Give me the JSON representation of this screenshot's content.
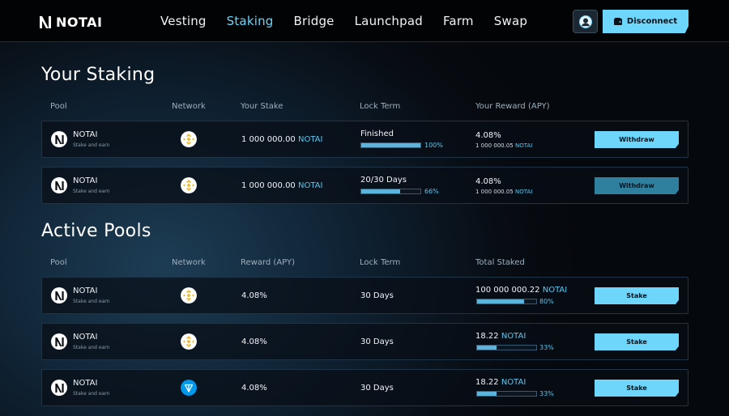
{
  "brand": {
    "name": "NOTAI"
  },
  "nav": {
    "links": [
      "Vesting",
      "Staking",
      "Bridge",
      "Launchpad",
      "Farm",
      "Swap"
    ],
    "active": "Staking",
    "disconnect_label": "Disconnect"
  },
  "your_staking": {
    "title": "Your Staking",
    "columns": [
      "Pool",
      "Network",
      "Your Stake",
      "Lock Term",
      "Your Reward (APY)"
    ],
    "rows": [
      {
        "pool_name": "NOTAI",
        "pool_sub": "Stake and earn",
        "network": "bnb-icon",
        "stake_amount": "1 000 000.00",
        "stake_token": "NOTAI",
        "lock_label": "Finished",
        "lock_progress": 100,
        "lock_pct": "100%",
        "apy": "4.08%",
        "reward_amount": "1 000 000.05",
        "reward_token": "NOTAI",
        "action": "Withdraw",
        "action_enabled": true
      },
      {
        "pool_name": "NOTAI",
        "pool_sub": "Stake and earn",
        "network": "bnb-icon",
        "stake_amount": "1 000 000.00",
        "stake_token": "NOTAI",
        "lock_label": "20/30 Days",
        "lock_progress": 66,
        "lock_pct": "66%",
        "apy": "4.08%",
        "reward_amount": "1 000 000.05",
        "reward_token": "NOTAI",
        "action": "Withdraw",
        "action_enabled": false
      }
    ]
  },
  "active_pools": {
    "title": "Active Pools",
    "columns": [
      "Pool",
      "Network",
      "Reward (APY)",
      "Lock Term",
      "Total Staked"
    ],
    "rows": [
      {
        "pool_name": "NOTAI",
        "pool_sub": "Stake and earn",
        "network": "bnb-icon",
        "apy": "4.08%",
        "lock_term": "30 Days",
        "total_amount": "100 000 000.22",
        "total_token": "NOTAI",
        "progress": 80,
        "pct": "80%",
        "action": "Stake"
      },
      {
        "pool_name": "NOTAI",
        "pool_sub": "Stake and earn",
        "network": "bnb-icon",
        "apy": "4.08%",
        "lock_term": "30 Days",
        "total_amount": "18.22",
        "total_token": "NOTAI",
        "progress": 33,
        "pct": "33%",
        "action": "Stake"
      },
      {
        "pool_name": "NOTAI",
        "pool_sub": "Stake and earn",
        "network": "ton-icon",
        "apy": "4.08%",
        "lock_term": "30 Days",
        "total_amount": "18.22",
        "total_token": "NOTAI",
        "progress": 33,
        "pct": "33%",
        "action": "Stake"
      }
    ]
  },
  "colors": {
    "accent": "#6dd6fa",
    "bnb": "#f3ba2f",
    "ton": "#0098ea"
  }
}
